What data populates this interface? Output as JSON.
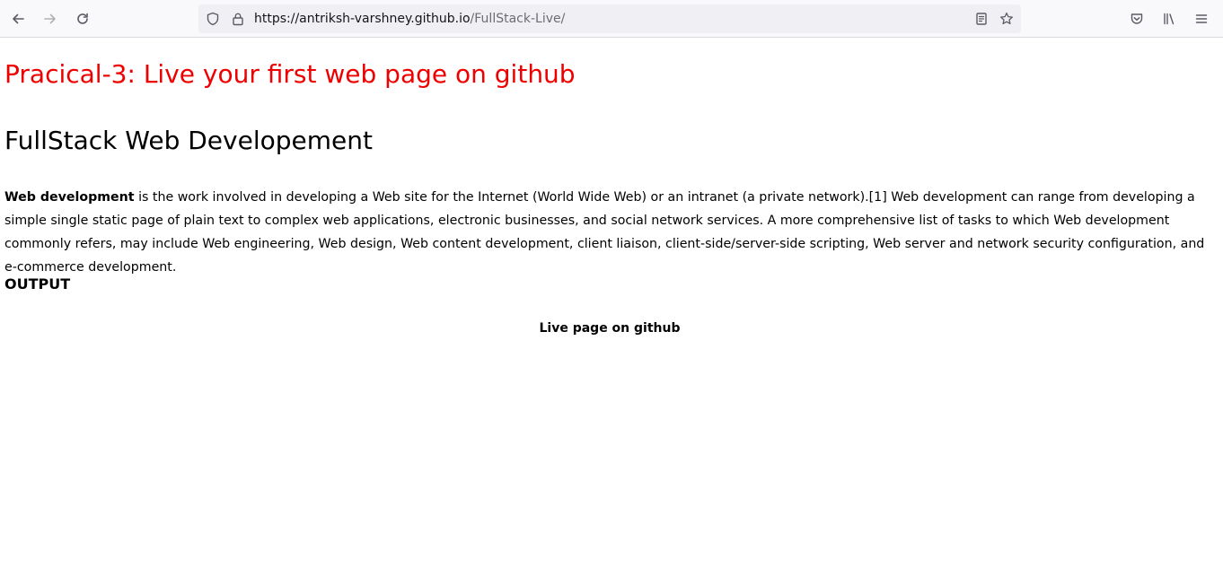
{
  "browser": {
    "url_host": "https://antriksh-varshney.github.io",
    "url_path": "/FullStack-Live/",
    "icons": {
      "back": "back-arrow-icon",
      "forward": "forward-arrow-icon",
      "reload": "reload-icon",
      "tracking": "shield-icon",
      "secure": "lock-icon",
      "reader": "reader-view-icon",
      "bookmark": "star-icon",
      "pocket": "pocket-icon",
      "library": "library-icon",
      "menu": "hamburger-menu-icon"
    }
  },
  "page": {
    "heading": "Pracical-3: Live your first web page on github",
    "heading_color": "#ee0000",
    "section_title": "FullStack Web Developement",
    "intro_bold": "Web development",
    "intro_rest": " is the work involved in developing a Web site for the Internet (World Wide Web) or an intranet (a private network).[1] Web development can range from developing a simple single static page of plain text to complex web applications, electronic businesses, and social network services. A more comprehensive list of tasks to which Web development commonly refers, may include Web engineering, Web design, Web content development, client liaison, client-side/server-side scripting, Web server and network security configuration, and e-commerce development.",
    "output_heading": "OUTPUT",
    "caption": "Live page on github"
  }
}
